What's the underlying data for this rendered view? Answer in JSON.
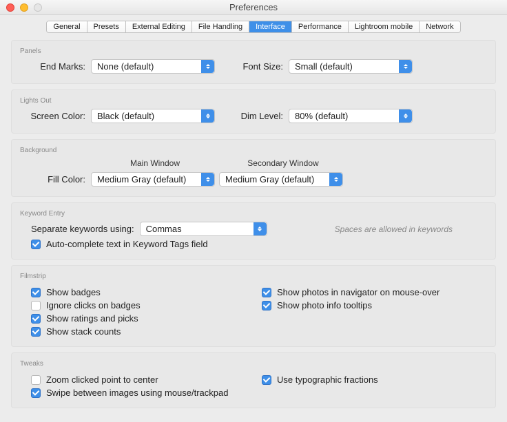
{
  "window_title": "Preferences",
  "tabs": {
    "general": "General",
    "presets": "Presets",
    "external_editing": "External Editing",
    "file_handling": "File Handling",
    "interface": "Interface",
    "performance": "Performance",
    "lightroom_mobile": "Lightroom mobile",
    "network": "Network"
  },
  "panels": {
    "title": "Panels",
    "end_marks_label": "End Marks:",
    "end_marks_value": "None (default)",
    "font_size_label": "Font Size:",
    "font_size_value": "Small (default)"
  },
  "lights_out": {
    "title": "Lights Out",
    "screen_color_label": "Screen Color:",
    "screen_color_value": "Black (default)",
    "dim_level_label": "Dim Level:",
    "dim_level_value": "80% (default)"
  },
  "background": {
    "title": "Background",
    "main_window": "Main Window",
    "secondary_window": "Secondary Window",
    "fill_color_label": "Fill Color:",
    "main_value": "Medium Gray (default)",
    "secondary_value": "Medium Gray (default)"
  },
  "keyword_entry": {
    "title": "Keyword Entry",
    "separate_label": "Separate keywords using:",
    "separate_value": "Commas",
    "hint": "Spaces are allowed in keywords",
    "autocomplete": "Auto-complete text in Keyword Tags field"
  },
  "filmstrip": {
    "title": "Filmstrip",
    "show_badges": "Show badges",
    "ignore_clicks": "Ignore clicks on badges",
    "show_ratings": "Show ratings and picks",
    "show_stack": "Show stack counts",
    "show_photos_nav": "Show photos in navigator on mouse-over",
    "show_tooltips": "Show photo info tooltips"
  },
  "tweaks": {
    "title": "Tweaks",
    "zoom_center": "Zoom clicked point to center",
    "swipe": "Swipe between images using mouse/trackpad",
    "typographic": "Use typographic fractions"
  }
}
